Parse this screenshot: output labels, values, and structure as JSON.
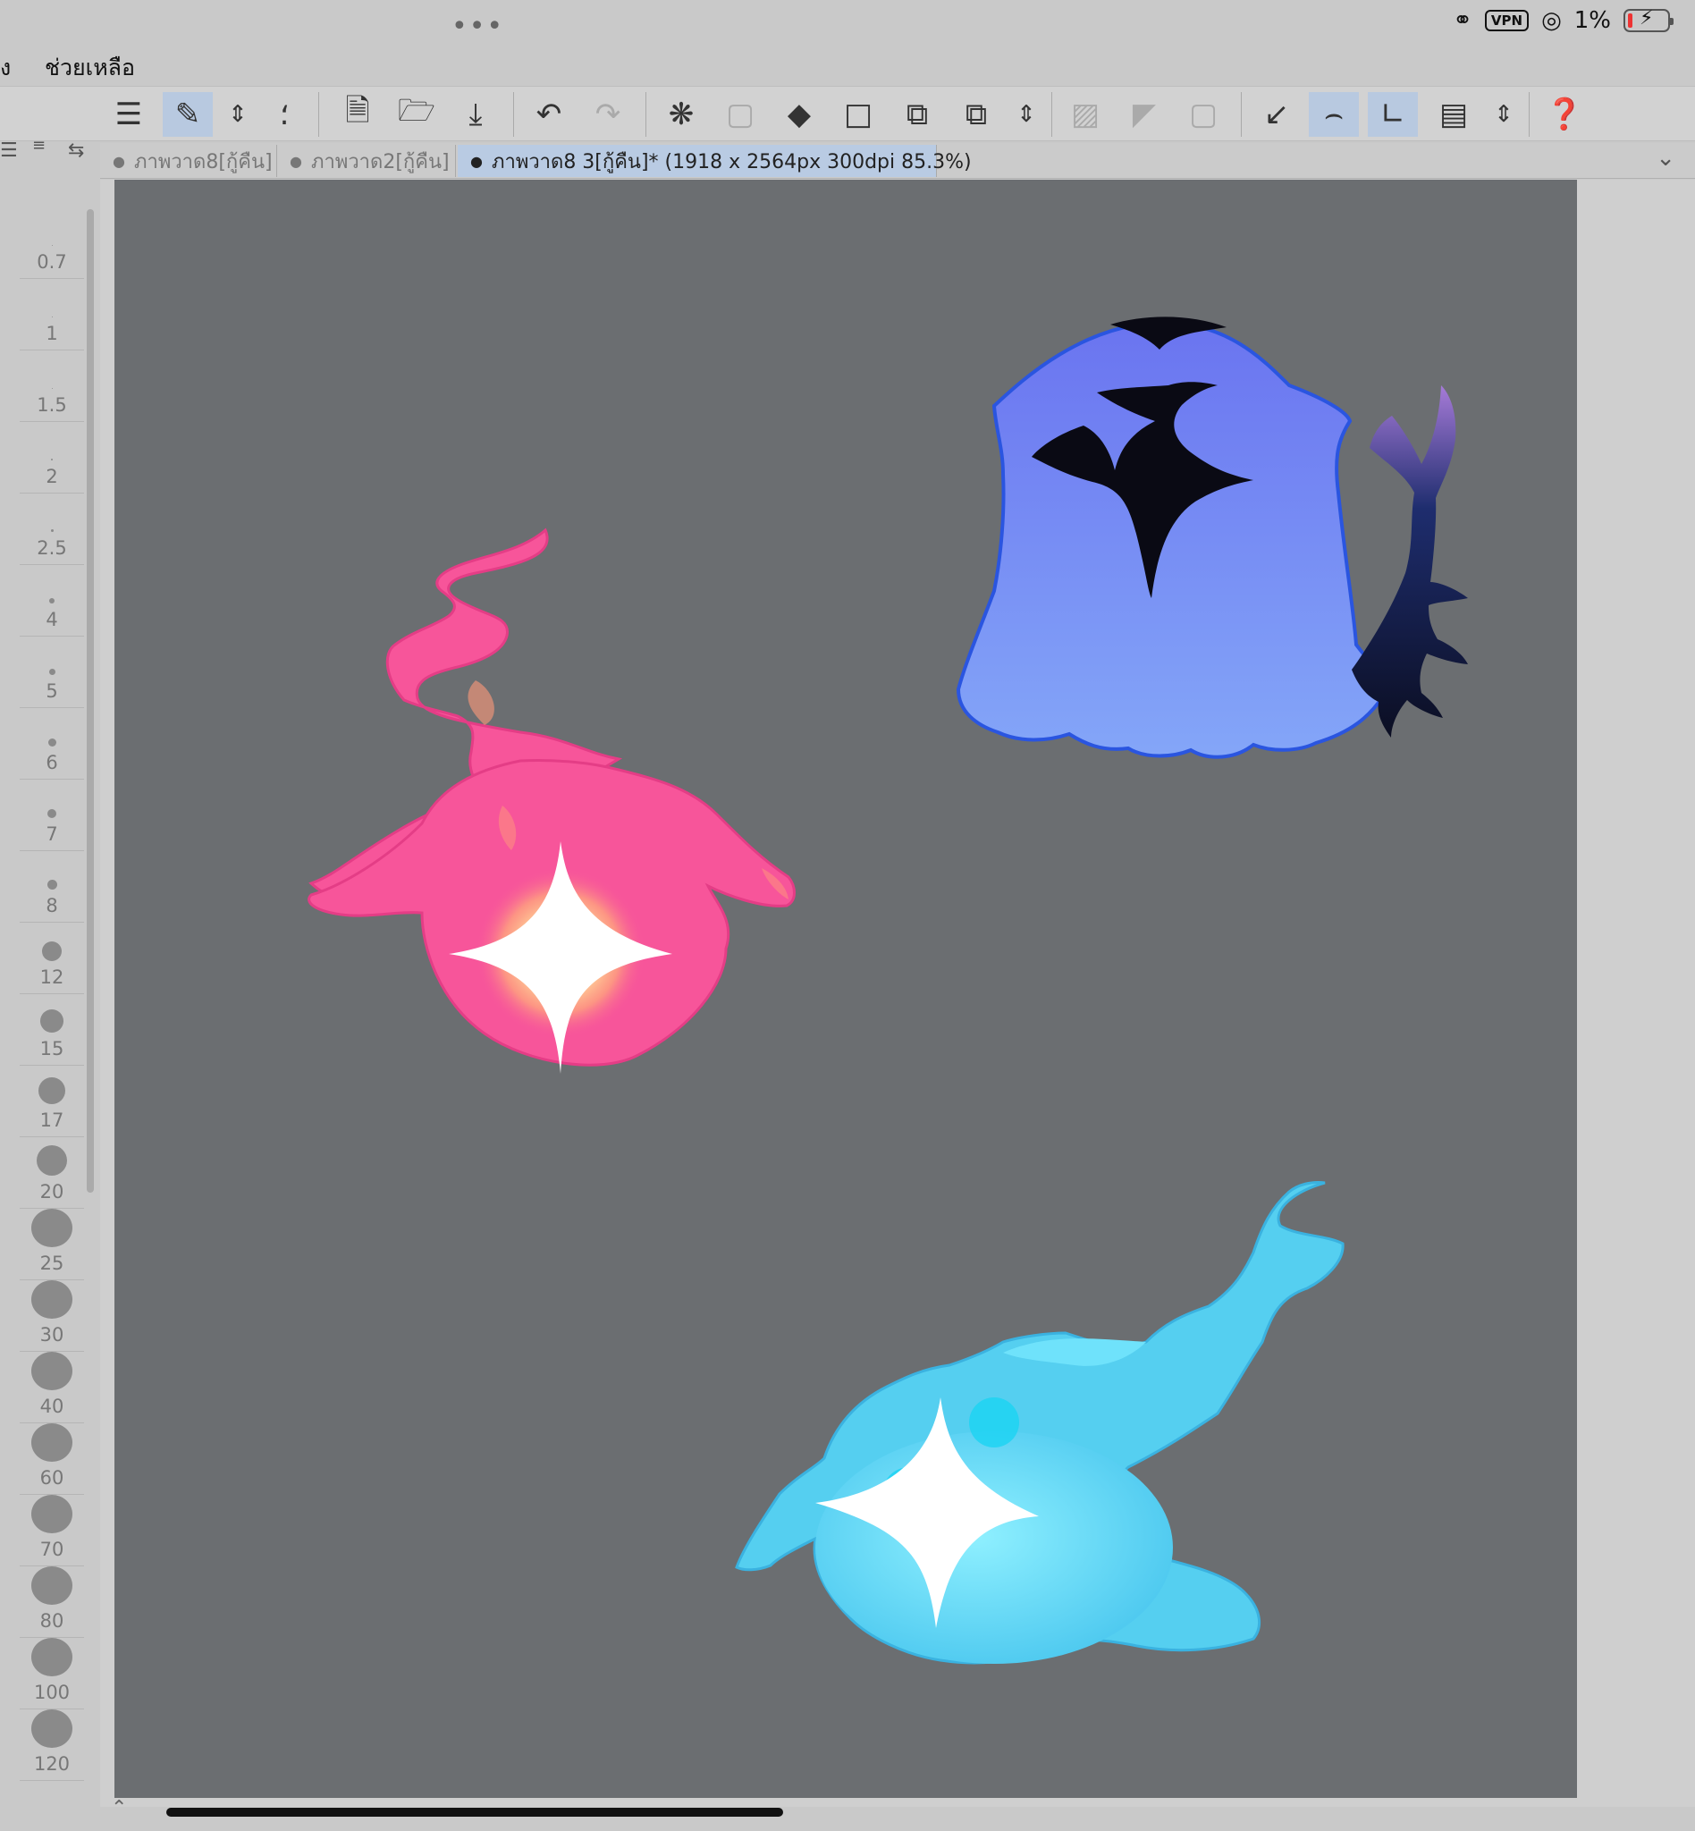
{
  "status_bar": {
    "dots": "•••",
    "vpn": "VPN",
    "battery_percent": "1%",
    "battery_level": 0.01
  },
  "menu": {
    "left_partial": "ง",
    "help": "ช่วยเหลือ"
  },
  "toolbar": {
    "items": [
      "menu-icon",
      "pen-edit-icon",
      "chevron-updown-icon",
      "spiral-icon",
      "new-canvas-icon",
      "open-folder-icon",
      "save-download-icon",
      "undo-icon",
      "redo-icon",
      "loading-spinner-icon",
      "selection-icon",
      "fill-bucket-icon",
      "transform-icon",
      "layer-select-icon",
      "layer-select-2-icon",
      "chevron-updown-2-icon",
      "deselect-icon",
      "invert-selection-icon",
      "selection-border-icon",
      "ruler-icon",
      "brush-stabilizer-icon",
      "snap-icon",
      "canvas-settings-icon",
      "chevron-updown-3-icon",
      "help-icon"
    ]
  },
  "tabs": [
    {
      "label": "ภาพวาด8[กู้คืน]"
    },
    {
      "label": "ภาพวาด2[กู้คืน]"
    },
    {
      "label": "ภาพวาด8 3[กู้คืน]* (1918 x 2564px 300dpi 85.3%)"
    }
  ],
  "brush_sizes": [
    "0.7",
    "1",
    "1.5",
    "2",
    "2.5",
    "4",
    "5",
    "6",
    "7",
    "8",
    "12",
    "15",
    "17",
    "20",
    "25",
    "30",
    "40",
    "60",
    "70",
    "80",
    "100",
    "120"
  ],
  "colors": {
    "canvas_bg": "#6b6e71",
    "pink_spirit": "#f7559a",
    "purple_ghost": "#7a86f5",
    "cyan_spirit": "#5fd8f2",
    "active_tab": "#b9cbe3"
  }
}
